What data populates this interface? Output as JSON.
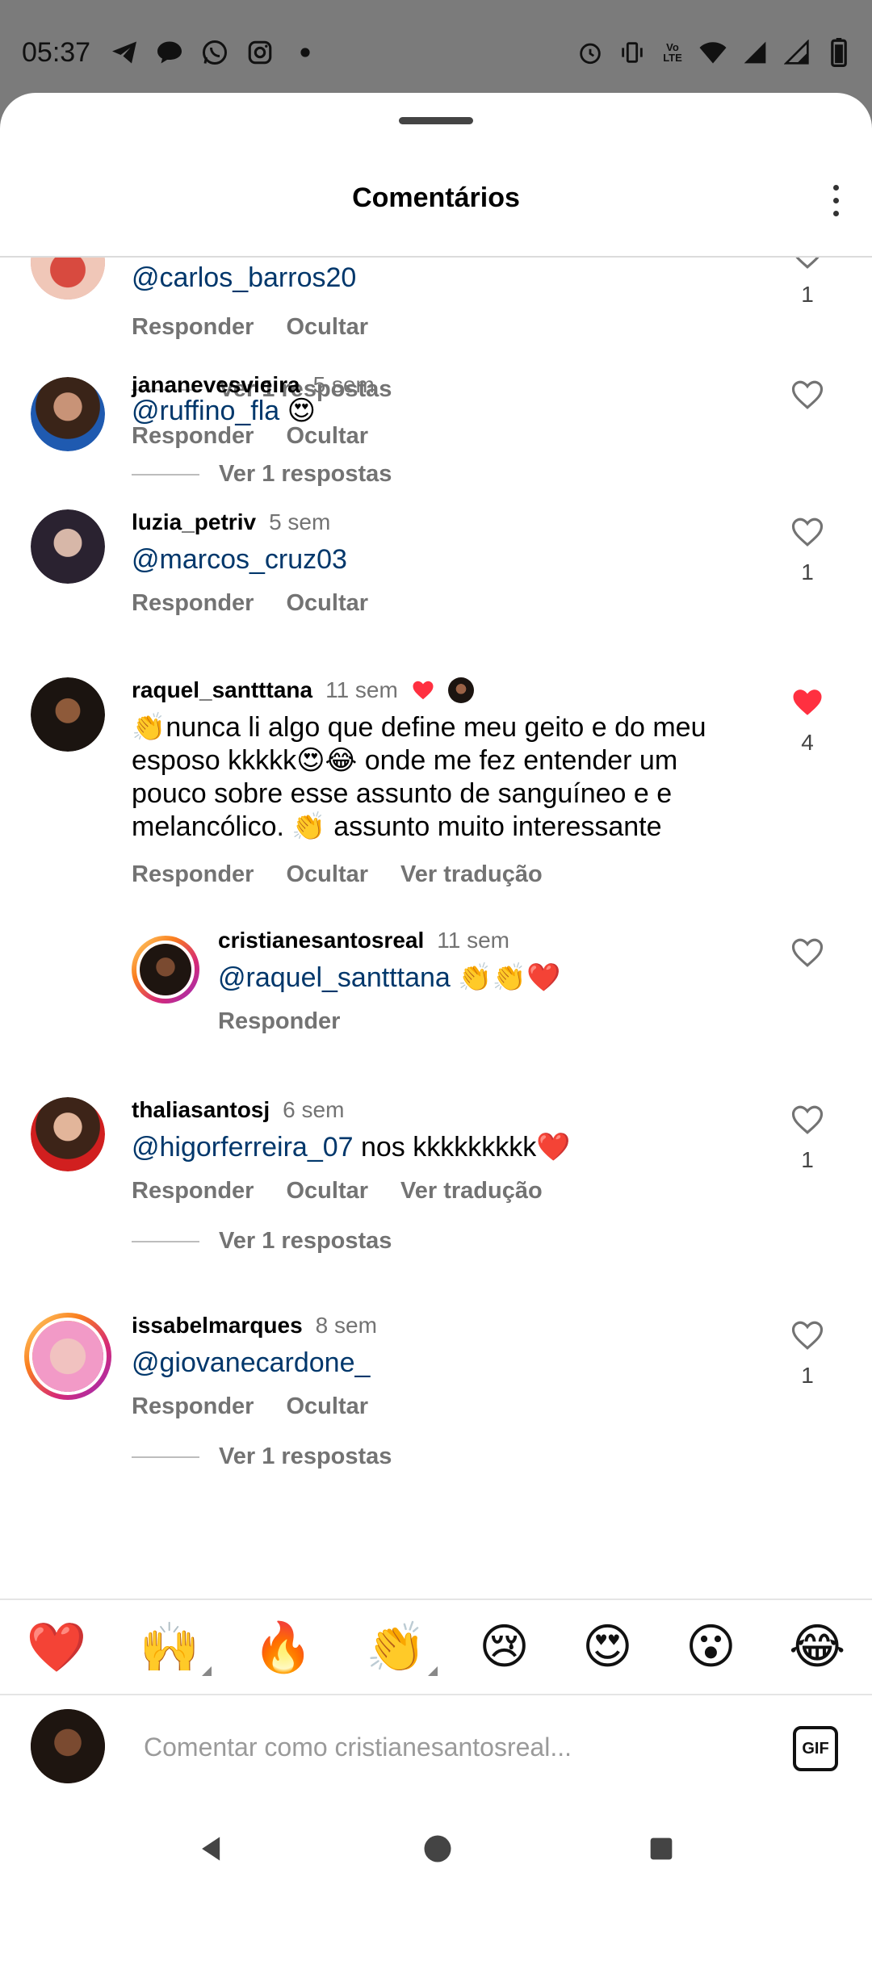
{
  "status_bar": {
    "time": "05:37",
    "left_icons": [
      "telegram-icon",
      "chat-icon",
      "whatsapp-icon",
      "instagram-icon",
      "dot-icon"
    ],
    "right_icons": [
      "alarm-icon",
      "vibrate-icon",
      "volte-icon",
      "wifi-icon",
      "signal-icon",
      "signal-icon-2",
      "battery-icon"
    ],
    "volte_label": "Vo LTE"
  },
  "sheet": {
    "title": "Comentários"
  },
  "comments": [
    {
      "username": "",
      "time": "",
      "mention": "@carlos_barros20",
      "text": "",
      "actions": [
        "Responder",
        "Ocultar"
      ],
      "like_count": "1",
      "liked": false,
      "replies": "Ver 1 respostas"
    },
    {
      "username": "jananevesvieira",
      "time": "5 sem",
      "mention": "@ruffino_fla",
      "text": "😍",
      "actions": [
        "Responder",
        "Ocultar"
      ],
      "like_count": "",
      "liked": false,
      "replies": "Ver 1 respostas"
    },
    {
      "username": "luzia_petriv",
      "time": "5 sem",
      "mention": "@marcos_cruz03",
      "text": "",
      "actions": [
        "Responder",
        "Ocultar"
      ],
      "like_count": "1",
      "liked": false,
      "replies": ""
    },
    {
      "username": "raquel_santttana",
      "time": "11 sem",
      "mention": "",
      "text": "👏nunca li algo que define meu geito e do meu esposo kkkkk😍😂 onde me fez entender um pouco sobre esse assunto de sanguíneo e e melancólico. 👏 assunto muito interessante",
      "actions": [
        "Responder",
        "Ocultar",
        "Ver tradução"
      ],
      "like_count": "4",
      "liked": true,
      "replies": ""
    },
    {
      "username": "cristianesantosreal",
      "time": "11 sem",
      "mention": "@raquel_santttana",
      "text": "👏👏❤️",
      "actions": [
        "Responder"
      ],
      "like_count": "",
      "liked": false,
      "replies": ""
    },
    {
      "username": "thaliasantosj",
      "time": "6 sem",
      "mention": "@higorferreira_07",
      "text": " nos kkkkkkkkk❤️",
      "actions": [
        "Responder",
        "Ocultar",
        "Ver tradução"
      ],
      "like_count": "1",
      "liked": false,
      "replies": "Ver 1 respostas"
    },
    {
      "username": "issabelmarques",
      "time": "8 sem",
      "mention": "@giovanecardone_",
      "text": "",
      "actions": [
        "Responder",
        "Ocultar"
      ],
      "like_count": "1",
      "liked": false,
      "replies": "Ver 1 respostas"
    }
  ],
  "emoji_bar": [
    "❤️",
    "🙌",
    "🔥",
    "👏",
    "😢",
    "😍",
    "😮",
    "😂"
  ],
  "comment_input": {
    "placeholder": "Comentar como cristianesantosreal..."
  },
  "gif_label": "GIF",
  "colors": {
    "mention": "#00376b",
    "liked_heart": "#ff3040",
    "muted_text": "#737373"
  }
}
